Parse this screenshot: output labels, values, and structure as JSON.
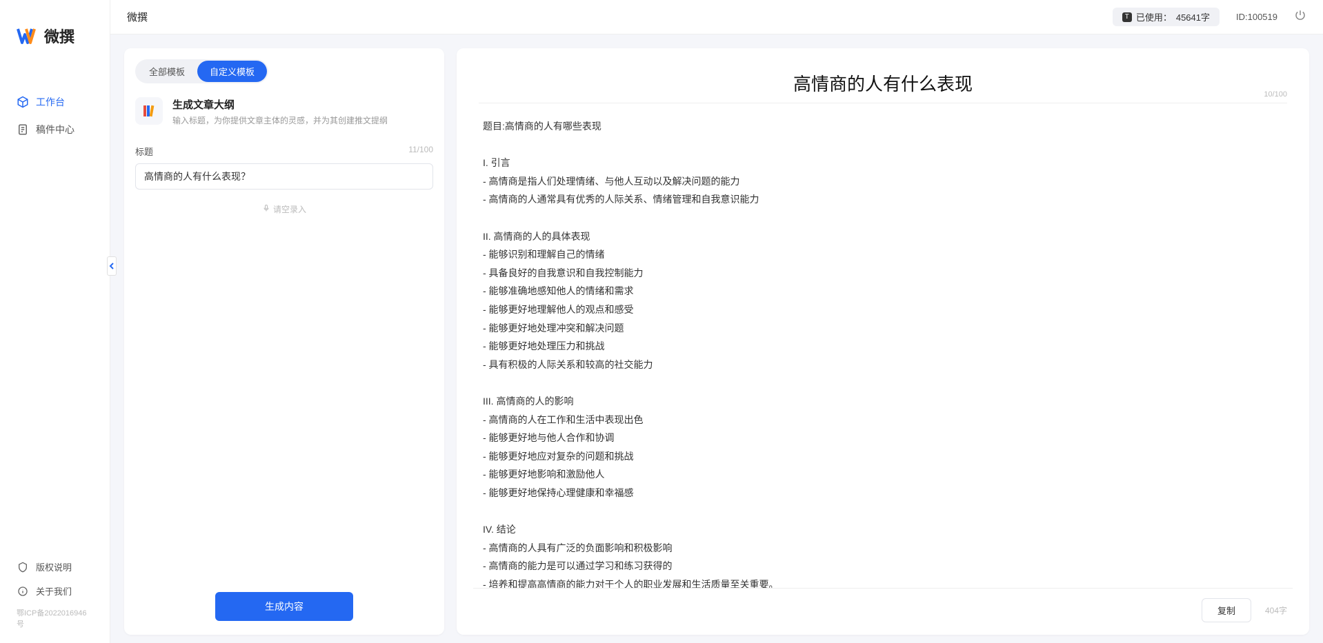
{
  "brand": {
    "name": "微撰"
  },
  "topbar": {
    "title": "微撰",
    "usage_prefix": "已使用：",
    "usage_value": "45641字",
    "id_label": "ID:100519"
  },
  "sidebar": {
    "nav": [
      {
        "label": "工作台",
        "icon": "cube-icon",
        "active": true
      },
      {
        "label": "稿件中心",
        "icon": "document-icon",
        "active": false
      }
    ],
    "bottom": [
      {
        "label": "版权说明",
        "icon": "shield-icon"
      },
      {
        "label": "关于我们",
        "icon": "info-icon"
      }
    ],
    "icp": "鄂ICP备2022016946号"
  },
  "left_panel": {
    "tabs": [
      {
        "label": "全部模板",
        "active": false
      },
      {
        "label": "自定义模板",
        "active": true
      }
    ],
    "template": {
      "title": "生成文章大纲",
      "desc": "输入标题，为你提供文章主体的灵感，并为其创建推文提纲"
    },
    "field": {
      "label": "标题",
      "count": "11/100",
      "value": "高情商的人有什么表现？"
    },
    "voice_hint": "请空录入",
    "generate_btn": "生成内容"
  },
  "right_panel": {
    "title": "高情商的人有什么表现",
    "title_count": "10/100",
    "body": "题目:高情商的人有哪些表现\n\nI. 引言\n- 高情商是指人们处理情绪、与他人互动以及解决问题的能力\n- 高情商的人通常具有优秀的人际关系、情绪管理和自我意识能力\n\nII. 高情商的人的具体表现\n- 能够识别和理解自己的情绪\n- 具备良好的自我意识和自我控制能力\n- 能够准确地感知他人的情绪和需求\n- 能够更好地理解他人的观点和感受\n- 能够更好地处理冲突和解决问题\n- 能够更好地处理压力和挑战\n- 具有积极的人际关系和较高的社交能力\n\nIII. 高情商的人的影响\n- 高情商的人在工作和生活中表现出色\n- 能够更好地与他人合作和协调\n- 能够更好地应对复杂的问题和挑战\n- 能够更好地影响和激励他人\n- 能够更好地保持心理健康和幸福感\n\nIV. 结论\n- 高情商的人具有广泛的负面影响和积极影响\n- 高情商的能力是可以通过学习和练习获得的\n- 培养和提高高情商的能力对于个人的职业发展和生活质量至关重要。",
    "copy_btn": "复制",
    "word_count": "404字"
  }
}
